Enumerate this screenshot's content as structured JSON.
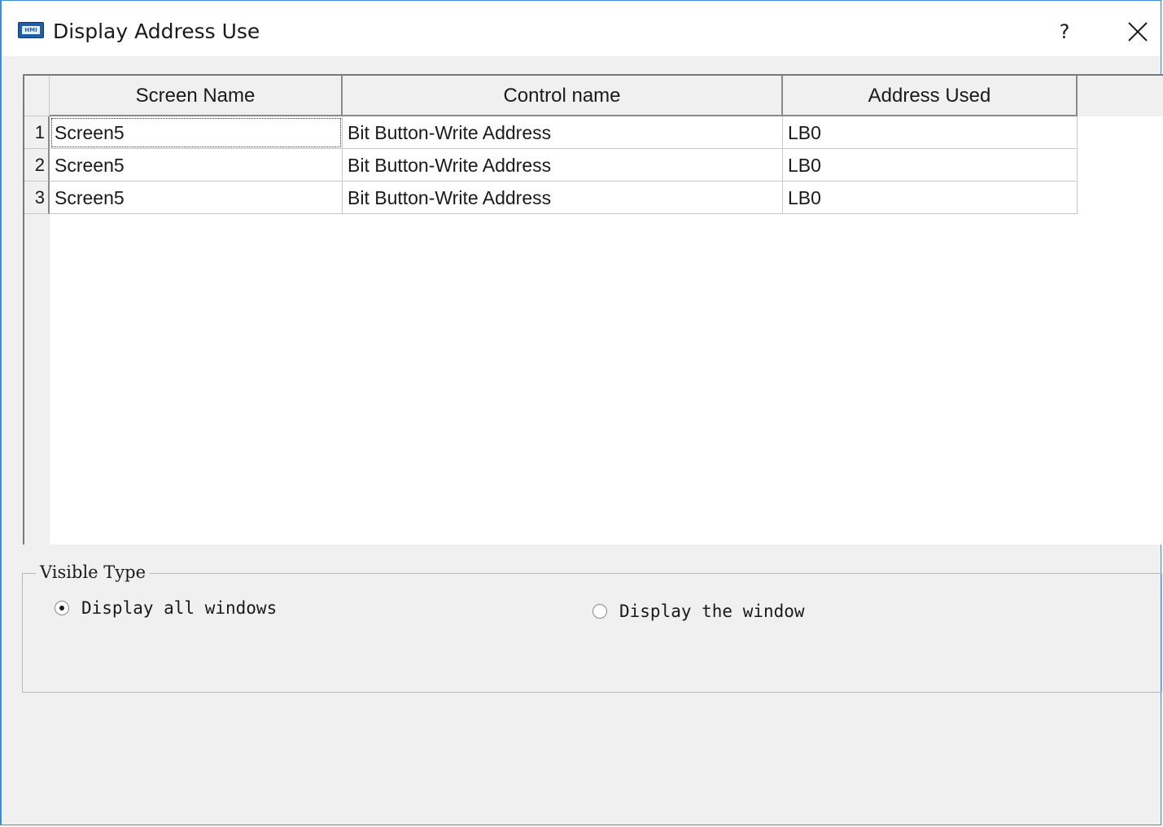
{
  "window": {
    "title": "Display Address Use",
    "icon": "hmi-app-icon",
    "icon_text": "HMI",
    "help_label": "?",
    "close_icon": "close-icon"
  },
  "grid": {
    "columns": [
      "Screen Name",
      "Control name",
      "Address Used"
    ],
    "rows": [
      {
        "num": "1",
        "screen_name": "Screen5",
        "control_name": "Bit Button-Write Address",
        "address_used": "LB0"
      },
      {
        "num": "2",
        "screen_name": "Screen5",
        "control_name": "Bit Button-Write Address",
        "address_used": "LB0"
      },
      {
        "num": "3",
        "screen_name": "Screen5",
        "control_name": "Bit Button-Write Address",
        "address_used": "LB0"
      }
    ]
  },
  "visible_type": {
    "legend": "Visible Type",
    "options": [
      {
        "label": "Display all windows",
        "selected": true
      },
      {
        "label": "Display the window",
        "selected": false
      }
    ]
  },
  "colors": {
    "window_border": "#3c8ddb",
    "dialog_bg": "#f0f0f0",
    "title_bg": "#ffffff"
  }
}
